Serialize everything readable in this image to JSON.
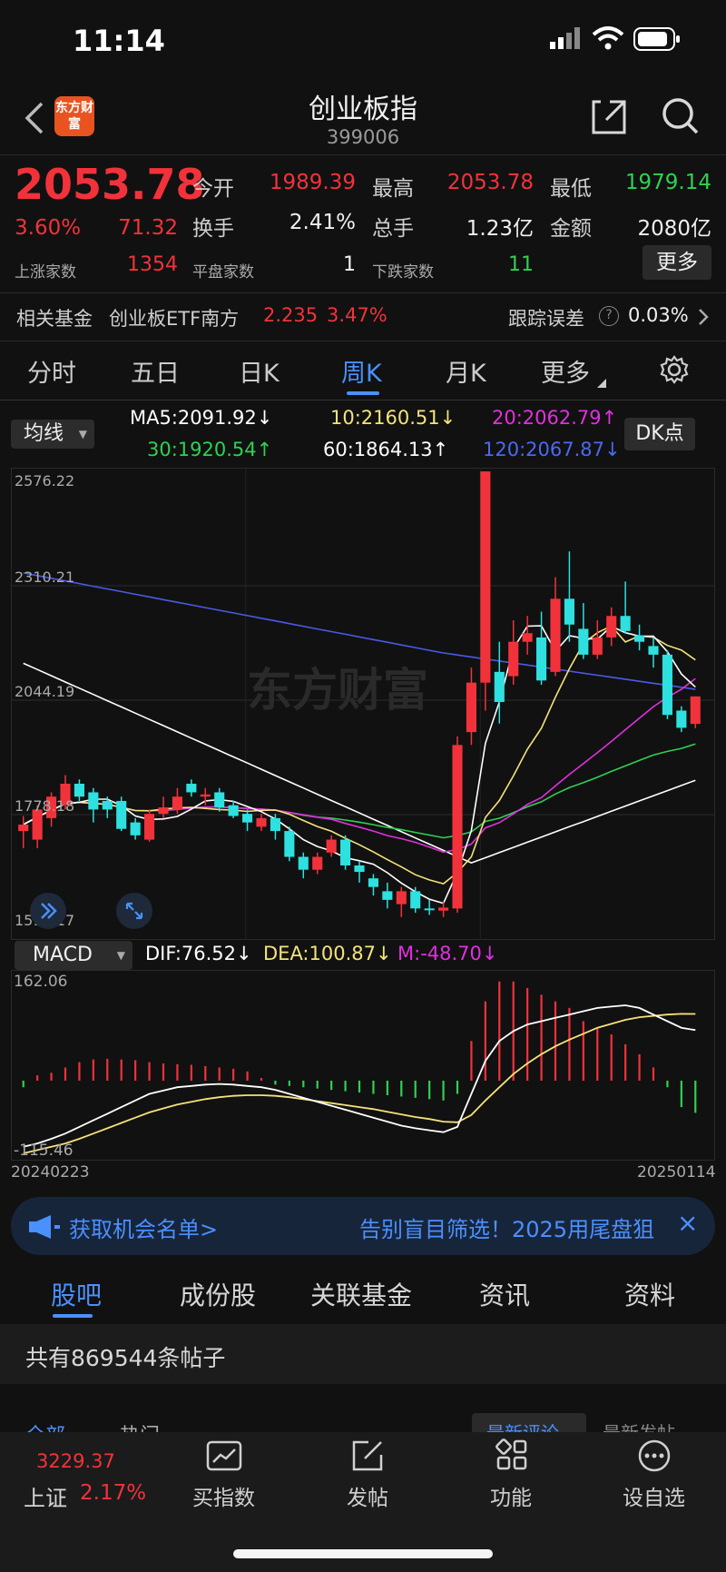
{
  "status": {
    "time": "11:14"
  },
  "header": {
    "logo_text": "东方财富",
    "title": "创业板指",
    "code": "399006"
  },
  "quote": {
    "price": "2053.78",
    "change_pct": "3.60%",
    "change": "71.32",
    "open_label": "今开",
    "open": "1989.39",
    "high_label": "最高",
    "high": "2053.78",
    "low_label": "最低",
    "low": "1979.14",
    "turnover_label": "换手",
    "turnover": "2.41%",
    "volume_label": "总手",
    "volume": "1.23亿",
    "amount_label": "金额",
    "amount": "2080亿",
    "up_label": "上涨家数",
    "up": "1354",
    "flat_label": "平盘家数",
    "flat": "1",
    "down_label": "下跌家数",
    "down": "11",
    "more_label": "更多"
  },
  "fund": {
    "label": "相关基金",
    "name": "创业板ETF南方",
    "price": "2.235",
    "pct": "3.47%",
    "track_label": "跟踪误差",
    "track_value": "0.03%"
  },
  "ktabs": [
    "分时",
    "五日",
    "日K",
    "周K",
    "月K",
    "更多"
  ],
  "ktab_active": 3,
  "ma_bar": {
    "selector": "均线",
    "ma5": "MA5:2091.92↓",
    "ma10": "10:2160.51↓",
    "ma20": "20:2062.79↑",
    "ma30": "30:1920.54↑",
    "ma60": "60:1864.13↑",
    "ma120": "120:2067.87↓",
    "dk_button": "DK点"
  },
  "chart_labels": {
    "y_ticks": [
      "2576.22",
      "2310.21",
      "2044.19",
      "1778.18",
      "1512.17"
    ],
    "watermark": "东方财富",
    "macd_selector": "MACD",
    "dif": "DIF:76.52↓",
    "dea": "DEA:100.87↓",
    "m": "M:-48.70↓",
    "macd_top": "162.06",
    "macd_bottom": "-115.46",
    "date_start": "20240223",
    "date_end": "20250114"
  },
  "colors": {
    "up": "#f2323b",
    "down": "#2ee0e0",
    "ma5": "#ffffff",
    "ma10": "#f5e37a",
    "ma20": "#e030e0",
    "ma30": "#2fd152",
    "ma60": "#ffffff",
    "ma120": "#4a5ae6",
    "accent": "#4a90ff"
  },
  "chart_data": {
    "type": "candlestick",
    "y_range": [
      1512.17,
      2576.22
    ],
    "candles": [
      {
        "o": 1740,
        "c": 1755,
        "h": 1775,
        "l": 1700
      },
      {
        "o": 1720,
        "c": 1790,
        "h": 1800,
        "l": 1700
      },
      {
        "o": 1770,
        "c": 1820,
        "h": 1830,
        "l": 1750
      },
      {
        "o": 1800,
        "c": 1850,
        "h": 1870,
        "l": 1790
      },
      {
        "o": 1850,
        "c": 1820,
        "h": 1860,
        "l": 1810
      },
      {
        "o": 1830,
        "c": 1790,
        "h": 1840,
        "l": 1760
      },
      {
        "o": 1810,
        "c": 1790,
        "h": 1820,
        "l": 1770
      },
      {
        "o": 1810,
        "c": 1745,
        "h": 1820,
        "l": 1740
      },
      {
        "o": 1760,
        "c": 1730,
        "h": 1770,
        "l": 1720
      },
      {
        "o": 1720,
        "c": 1780,
        "h": 1790,
        "l": 1715
      },
      {
        "o": 1780,
        "c": 1795,
        "h": 1820,
        "l": 1770
      },
      {
        "o": 1790,
        "c": 1820,
        "h": 1840,
        "l": 1780
      },
      {
        "o": 1850,
        "c": 1830,
        "h": 1860,
        "l": 1820
      },
      {
        "o": 1820,
        "c": 1825,
        "h": 1840,
        "l": 1800
      },
      {
        "o": 1830,
        "c": 1795,
        "h": 1840,
        "l": 1785
      },
      {
        "o": 1800,
        "c": 1775,
        "h": 1810,
        "l": 1770
      },
      {
        "o": 1780,
        "c": 1760,
        "h": 1790,
        "l": 1740
      },
      {
        "o": 1750,
        "c": 1770,
        "h": 1780,
        "l": 1740
      },
      {
        "o": 1770,
        "c": 1740,
        "h": 1780,
        "l": 1720
      },
      {
        "o": 1740,
        "c": 1680,
        "h": 1750,
        "l": 1670
      },
      {
        "o": 1680,
        "c": 1650,
        "h": 1690,
        "l": 1630
      },
      {
        "o": 1650,
        "c": 1680,
        "h": 1690,
        "l": 1640
      },
      {
        "o": 1690,
        "c": 1720,
        "h": 1730,
        "l": 1680
      },
      {
        "o": 1720,
        "c": 1660,
        "h": 1730,
        "l": 1650
      },
      {
        "o": 1660,
        "c": 1645,
        "h": 1670,
        "l": 1620
      },
      {
        "o": 1630,
        "c": 1610,
        "h": 1640,
        "l": 1590
      },
      {
        "o": 1600,
        "c": 1580,
        "h": 1620,
        "l": 1560
      },
      {
        "o": 1570,
        "c": 1600,
        "h": 1610,
        "l": 1540
      },
      {
        "o": 1600,
        "c": 1560,
        "h": 1610,
        "l": 1550
      },
      {
        "o": 1560,
        "c": 1558,
        "h": 1580,
        "l": 1545
      },
      {
        "o": 1555,
        "c": 1562,
        "h": 1575,
        "l": 1540
      },
      {
        "o": 1560,
        "c": 1940,
        "h": 1960,
        "l": 1550
      },
      {
        "o": 1970,
        "c": 2085,
        "h": 2120,
        "l": 1940
      },
      {
        "o": 2085,
        "c": 2576,
        "h": 2576,
        "l": 2020
      },
      {
        "o": 2110,
        "c": 2040,
        "h": 2180,
        "l": 1990
      },
      {
        "o": 2100,
        "c": 2180,
        "h": 2230,
        "l": 2080
      },
      {
        "o": 2180,
        "c": 2200,
        "h": 2240,
        "l": 2150
      },
      {
        "o": 2190,
        "c": 2090,
        "h": 2250,
        "l": 2080
      },
      {
        "o": 2110,
        "c": 2280,
        "h": 2330,
        "l": 2100
      },
      {
        "o": 2280,
        "c": 2220,
        "h": 2390,
        "l": 2180
      },
      {
        "o": 2210,
        "c": 2150,
        "h": 2270,
        "l": 2140
      },
      {
        "o": 2150,
        "c": 2190,
        "h": 2230,
        "l": 2140
      },
      {
        "o": 2190,
        "c": 2240,
        "h": 2260,
        "l": 2170
      },
      {
        "o": 2240,
        "c": 2205,
        "h": 2320,
        "l": 2200
      },
      {
        "o": 2195,
        "c": 2180,
        "h": 2220,
        "l": 2160
      },
      {
        "o": 2170,
        "c": 2150,
        "h": 2190,
        "l": 2120
      },
      {
        "o": 2150,
        "c": 2010,
        "h": 2160,
        "l": 2000
      },
      {
        "o": 2020,
        "c": 1980,
        "h": 2030,
        "l": 1970
      },
      {
        "o": 1989,
        "c": 2053,
        "h": 2053,
        "l": 1979
      }
    ],
    "macd_range": [
      -115.46,
      162.06
    ],
    "macd_bars": [
      -10,
      8,
      12,
      20,
      28,
      32,
      33,
      32,
      31,
      28,
      26,
      25,
      24,
      22,
      20,
      18,
      14,
      4,
      -6,
      -8,
      -10,
      -12,
      -14,
      -16,
      -18,
      -20,
      -22,
      -24,
      -26,
      -28,
      -30,
      -20,
      60,
      120,
      150,
      150,
      140,
      130,
      120,
      110,
      90,
      80,
      70,
      55,
      40,
      20,
      -10,
      -40,
      -48.7
    ],
    "dif": [
      -100,
      -95,
      -88,
      -80,
      -70,
      -60,
      -50,
      -40,
      -30,
      -20,
      -15,
      -10,
      -8,
      -6,
      -5,
      -6,
      -8,
      -10,
      -14,
      -20,
      -26,
      -32,
      -38,
      -44,
      -50,
      -56,
      -62,
      -68,
      -72,
      -75,
      -78,
      -70,
      -20,
      30,
      60,
      75,
      85,
      90,
      95,
      100,
      105,
      110,
      112,
      114,
      110,
      100,
      90,
      80,
      76.52
    ],
    "dea": [
      -110,
      -105,
      -100,
      -95,
      -88,
      -80,
      -72,
      -64,
      -56,
      -48,
      -42,
      -36,
      -32,
      -28,
      -25,
      -23,
      -22,
      -22,
      -23,
      -25,
      -28,
      -31,
      -34,
      -37,
      -40,
      -43,
      -47,
      -51,
      -55,
      -58,
      -62,
      -63,
      -52,
      -30,
      -10,
      10,
      26,
      40,
      52,
      62,
      71,
      80,
      86,
      92,
      96,
      98,
      100,
      101,
      100.87
    ]
  },
  "banner": {
    "left": "获取机会名单>",
    "right": "告别盲目筛选！2025用尾盘狙",
    "close": "×"
  },
  "btabs": [
    "股吧",
    "成份股",
    "关联基金",
    "资讯",
    "资料"
  ],
  "btab_active": 0,
  "posts": {
    "text": "共有869544条帖子"
  },
  "peek": {
    "a": "全部",
    "b": "热门",
    "c": "最新评论",
    "d": "最新发帖"
  },
  "nav": {
    "sh_price": "3229.37",
    "sh_label": "上证",
    "sh_pct": "2.17%",
    "items": [
      "买指数",
      "发帖",
      "功能",
      "设自选"
    ]
  }
}
